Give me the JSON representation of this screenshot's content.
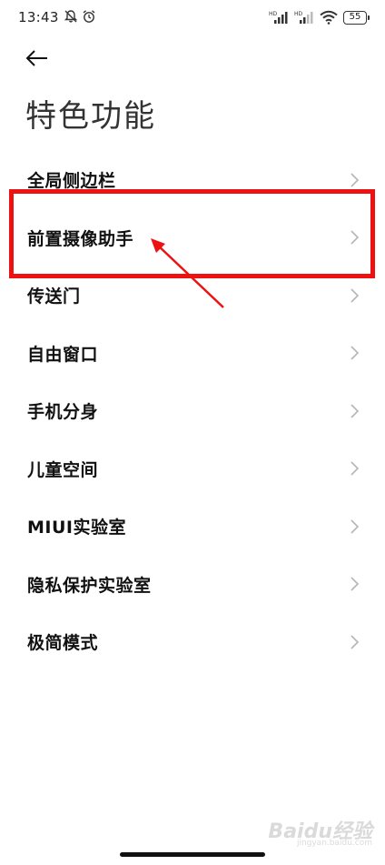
{
  "status_bar": {
    "time": "13:43",
    "battery": "55",
    "signal_badges": [
      "HD",
      "HD"
    ]
  },
  "header": {
    "title": "特色功能"
  },
  "list": {
    "items": [
      {
        "label": "全局侧边栏"
      },
      {
        "label": "前置摄像助手"
      },
      {
        "label": "传送门"
      },
      {
        "label": "自由窗口"
      },
      {
        "label": "手机分身"
      },
      {
        "label": "儿童空间"
      },
      {
        "label": "MIUI实验室"
      },
      {
        "label": "隐私保护实验室"
      },
      {
        "label": "极简模式"
      }
    ]
  },
  "annotation": {
    "highlighted_item": "前置摄像助手",
    "color": "#ee1111"
  },
  "watermark": {
    "text": "Baidu经验",
    "sub": "jingyan.baidu.com"
  },
  "colors": {
    "background": "#ffffff",
    "text": "#111111",
    "chevron": "#b5b5b5"
  }
}
